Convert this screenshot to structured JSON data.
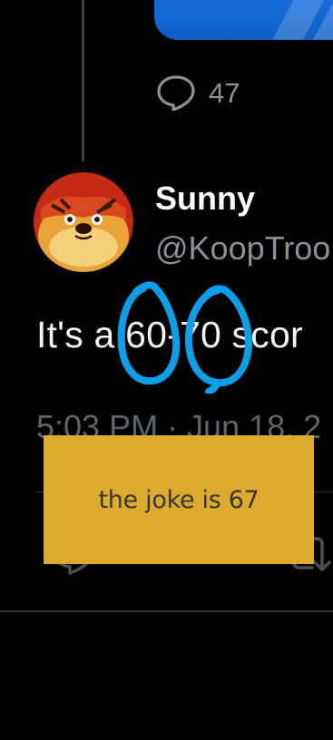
{
  "previous_tweet": {
    "reply_count": "47",
    "media_color": "#1877ea"
  },
  "tweet": {
    "display_name": "Sunny",
    "handle": "@KoopTroo",
    "text": "It's a 60-70 scor",
    "timestamp": "5:03 PM · Jun 18, 2"
  },
  "annotation": {
    "note_text": "the joke is 67",
    "note_color": "#dcaa2d",
    "circle_color": "#0a9fe8"
  },
  "actions": {
    "reply_icon": "comment-icon",
    "retweet_icon": "retweet-icon"
  }
}
